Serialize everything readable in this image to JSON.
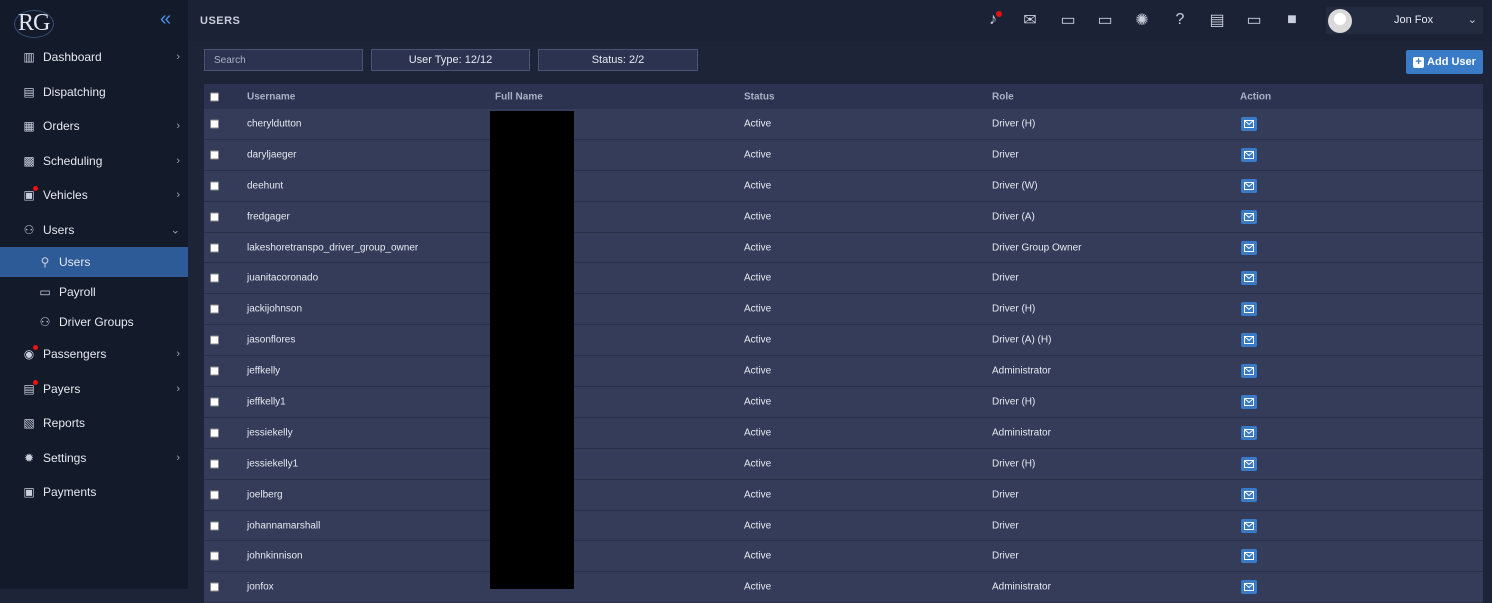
{
  "app": {
    "logo_text": "RG",
    "page_title": "USERS"
  },
  "sidebar": {
    "items": [
      {
        "label": "Dashboard",
        "icon": "chart-icon",
        "chevron": "›",
        "dot": false
      },
      {
        "label": "Dispatching",
        "icon": "dispatch-icon",
        "chevron": "",
        "dot": false
      },
      {
        "label": "Orders",
        "icon": "orders-icon",
        "chevron": "›",
        "dot": false
      },
      {
        "label": "Scheduling",
        "icon": "calendar-icon",
        "chevron": "›",
        "dot": false
      },
      {
        "label": "Vehicles",
        "icon": "bus-icon",
        "chevron": "›",
        "dot": true
      },
      {
        "label": "Users",
        "icon": "users-icon",
        "chevron": "⌄",
        "dot": false
      }
    ],
    "sub_items": [
      {
        "label": "Users",
        "icon": "user-icon",
        "active": true
      },
      {
        "label": "Payroll",
        "icon": "card-icon",
        "active": false
      },
      {
        "label": "Driver Groups",
        "icon": "group-icon",
        "active": false
      }
    ],
    "items_after": [
      {
        "label": "Passengers",
        "icon": "passenger-icon",
        "chevron": "›",
        "dot": true
      },
      {
        "label": "Payers",
        "icon": "briefcase-icon",
        "chevron": "›",
        "dot": true
      },
      {
        "label": "Reports",
        "icon": "reports-icon",
        "chevron": "",
        "dot": false
      },
      {
        "label": "Settings",
        "icon": "gear-icon",
        "chevron": "›",
        "dot": false
      },
      {
        "label": "Payments",
        "icon": "wallet-icon",
        "chevron": "",
        "dot": false
      }
    ]
  },
  "topbar": {
    "icons": [
      "notification-bell-icon",
      "mail-open-icon",
      "chat-add-icon",
      "chat-icon",
      "bug-icon",
      "help-icon",
      "document-icon",
      "cast-icon",
      "video-icon"
    ],
    "user_name": "Jon Fox"
  },
  "toolbar": {
    "search_placeholder": "Search",
    "user_type_filter": "User Type: 12/12",
    "status_filter": "Status: 2/2",
    "add_user_label": "Add User"
  },
  "table": {
    "columns": [
      "Username",
      "Full Name",
      "Status",
      "Role",
      "Action"
    ],
    "rows": [
      {
        "username": "cheryldutton",
        "status": "Active",
        "role": "Driver (H)"
      },
      {
        "username": "daryljaeger",
        "status": "Active",
        "role": "Driver"
      },
      {
        "username": "deehunt",
        "status": "Active",
        "role": "Driver (W)"
      },
      {
        "username": "fredgager",
        "status": "Active",
        "role": "Driver (A)"
      },
      {
        "username": "lakeshoretranspo_driver_group_owner",
        "status": "Active",
        "role": "Driver Group Owner"
      },
      {
        "username": "juanitacoronado",
        "status": "Active",
        "role": "Driver"
      },
      {
        "username": "jackijohnson",
        "status": "Active",
        "role": "Driver (H)"
      },
      {
        "username": "jasonflores",
        "status": "Active",
        "role": "Driver (A) (H)"
      },
      {
        "username": "jeffkelly",
        "status": "Active",
        "role": "Administrator"
      },
      {
        "username": "jeffkelly1",
        "status": "Active",
        "role": "Driver (H)"
      },
      {
        "username": "jessiekelly",
        "status": "Active",
        "role": "Administrator"
      },
      {
        "username": "jessiekelly1",
        "status": "Active",
        "role": "Driver (H)"
      },
      {
        "username": "joelberg",
        "status": "Active",
        "role": "Driver"
      },
      {
        "username": "johannamarshall",
        "status": "Active",
        "role": "Driver"
      },
      {
        "username": "johnkinnison",
        "status": "Active",
        "role": "Driver"
      },
      {
        "username": "jonfox",
        "status": "Active",
        "role": "Administrator"
      }
    ]
  },
  "colors": {
    "accent": "#3a7bc8",
    "active_nav": "#2d5b97",
    "notification_dot": "#e11111"
  }
}
